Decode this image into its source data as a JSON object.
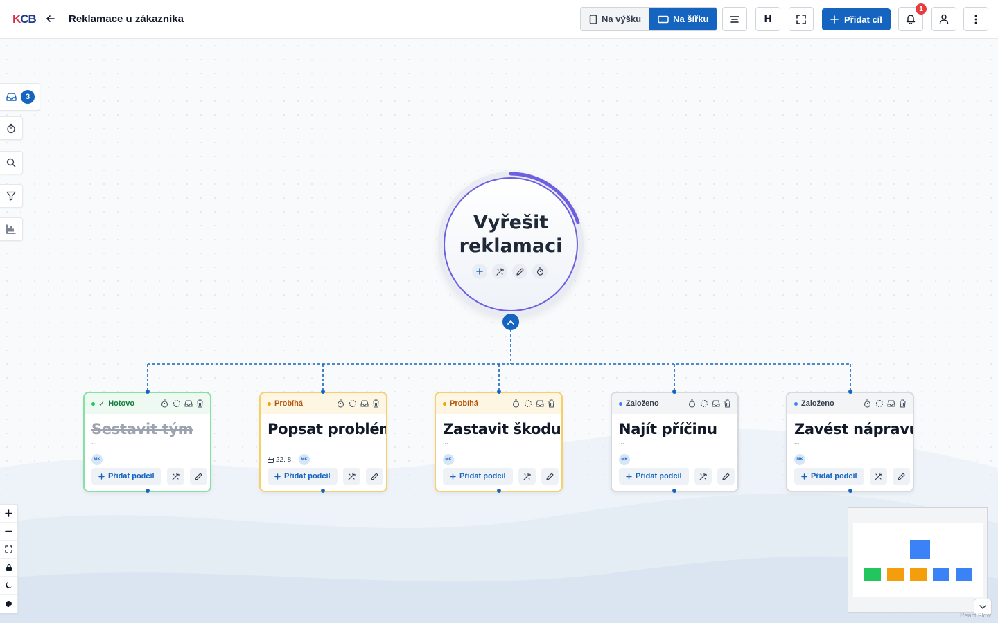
{
  "header": {
    "logo": "KCB",
    "title": "Reklamace u zákazníka",
    "orientation": {
      "portrait_label": "Na výšku",
      "landscape_label": "Na šířku",
      "selected": "Na šířku"
    },
    "heading_button_label": "H",
    "add_goal_label": "Přidat cíl",
    "notification_count": "1"
  },
  "sidebar": {
    "inbox_count": "3",
    "tools": [
      "inbox-icon",
      "timer-icon",
      "search-icon",
      "filter-icon",
      "chart-icon"
    ]
  },
  "root_goal": {
    "title": "Vyřešit reklamaci",
    "progress": 0.2,
    "progress_color": "#6d5fe0"
  },
  "goals": [
    {
      "status": "Hotovo",
      "status_check": "✓",
      "title": "Sestavit tým",
      "desc": "...",
      "date": "",
      "assignee": "MK",
      "add_label": "Přidat podcíl",
      "variant": "done"
    },
    {
      "status": "Probíhá",
      "status_check": "",
      "title": "Popsat problém",
      "desc": "",
      "date": "22. 8.",
      "assignee": "MK",
      "add_label": "Přidat podcíl",
      "variant": "in-progress"
    },
    {
      "status": "Probíhá",
      "status_check": "",
      "title": "Zastavit škodu",
      "desc": "...",
      "date": "",
      "assignee": "MK",
      "add_label": "Přidat podcíl",
      "variant": "in-progress"
    },
    {
      "status": "Založeno",
      "status_check": "",
      "title": "Najít příčinu",
      "desc": "...",
      "date": "",
      "assignee": "MK",
      "add_label": "Přidat podcíl",
      "variant": "created"
    },
    {
      "status": "Založeno",
      "status_check": "",
      "title": "Zavést nápravu",
      "desc": "...",
      "date": "",
      "assignee": "MK",
      "add_label": "Přidat podcíl",
      "variant": "created"
    }
  ],
  "status_colors": {
    "done": "#22c55e",
    "in_progress": "#f59e0b",
    "created": "#3b82f6"
  },
  "accent_color": "#1565c0",
  "minimap": {
    "attribution": "React Flow"
  }
}
